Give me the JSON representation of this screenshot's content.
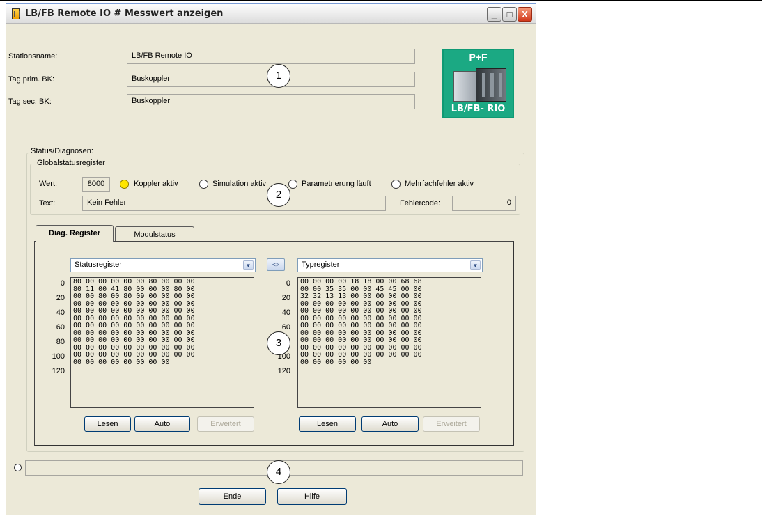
{
  "window": {
    "title": "LB/FB Remote IO # Messwert anzeigen",
    "min": "_",
    "max": "□",
    "close": "X"
  },
  "station": {
    "name_label": "Stationsname:",
    "name_value": "LB/FB Remote IO",
    "prim_label": "Tag prim. BK:",
    "prim_value": "Buskoppler",
    "sec_label": "Tag sec. BK:",
    "sec_value": "Buskoppler"
  },
  "logo": {
    "top": "P+F",
    "bottom": "LB/FB- RIO"
  },
  "status": {
    "group_label": "Status/Diagnosen:",
    "global_label": "Globalstatusregister",
    "wert_label": "Wert:",
    "wert_value": "8000",
    "radios": [
      "Koppler aktiv",
      "Simulation aktiv",
      "Parametrierung läuft",
      "Mehrfachfehler aktiv"
    ],
    "text_label": "Text:",
    "text_value": "Kein Fehler",
    "fehler_label": "Fehlercode:",
    "fehler_value": "0"
  },
  "tabs": [
    "Diag. Register",
    "Modulstatus"
  ],
  "left_panel": {
    "select": "Statusregister",
    "row_labels": [
      "0",
      "20",
      "40",
      "60",
      "80",
      "100",
      "120"
    ],
    "hex": "80 00 00 00 00 00 80 00 00 00\n80 11 00 41 80 00 00 00 80 00\n00 00 80 00 80 09 00 00 00 00\n00 00 00 00 00 00 00 00 00 00\n00 00 00 00 00 00 00 00 00 00\n00 00 00 00 00 00 00 00 00 00\n00 00 00 00 00 00 00 00 00 00\n00 00 00 00 00 00 00 00 00 00\n00 00 00 00 00 00 00 00 00 00\n00 00 00 00 00 00 00 00 00 00\n00 00 00 00 00 00 00 00 00 00\n00 00 00 00 00 00 00 00",
    "buttons": [
      "Lesen",
      "Auto",
      "Erweitert"
    ]
  },
  "swap_label": "<>",
  "right_panel": {
    "select": "Typregister",
    "row_labels": [
      "0",
      "20",
      "40",
      "60",
      "80",
      "100",
      "120"
    ],
    "hex": "00 00 00 00 18 18 00 00 68 68\n00 00 35 35 00 00 45 45 00 00\n32 32 13 13 00 00 00 00 00 00\n00 00 00 00 00 00 00 00 00 00\n00 00 00 00 00 00 00 00 00 00\n00 00 00 00 00 00 00 00 00 00\n00 00 00 00 00 00 00 00 00 00\n00 00 00 00 00 00 00 00 00 00\n00 00 00 00 00 00 00 00 00 00\n00 00 00 00 00 00 00 00 00 00\n00 00 00 00 00 00 00 00 00 00\n00 00 00 00 00 00",
    "buttons": [
      "Lesen",
      "Auto",
      "Erweitert"
    ]
  },
  "callouts": [
    "1",
    "2",
    "3",
    "4"
  ],
  "footer": {
    "ende": "Ende",
    "hilfe": "Hilfe"
  }
}
